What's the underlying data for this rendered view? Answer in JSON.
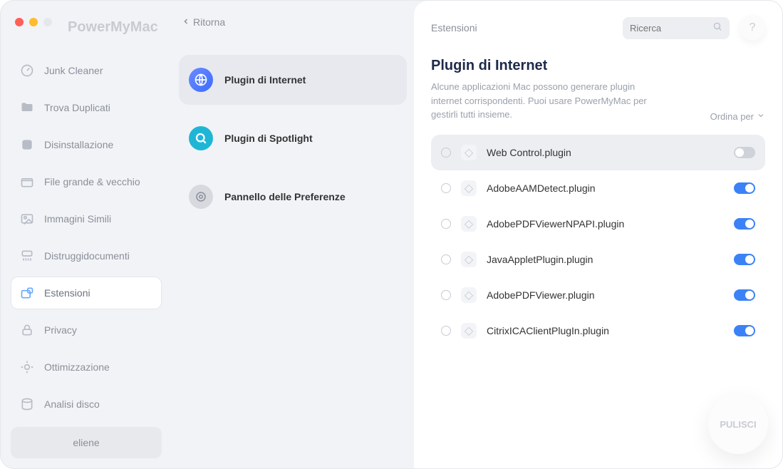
{
  "brand": "PowerMyMac",
  "sidebar": {
    "items": [
      {
        "label": "Junk Cleaner"
      },
      {
        "label": "Trova Duplicati"
      },
      {
        "label": "Disinstallazione"
      },
      {
        "label": "File grande & vecchio"
      },
      {
        "label": "Immagini Simili"
      },
      {
        "label": "Distruggidocumenti"
      },
      {
        "label": "Estensioni"
      },
      {
        "label": "Privacy"
      },
      {
        "label": "Ottimizzazione"
      },
      {
        "label": "Analisi disco"
      }
    ],
    "user": "eliene"
  },
  "back_label": "Ritorna",
  "categories": [
    {
      "label": "Plugin di Internet"
    },
    {
      "label": "Plugin di Spotlight"
    },
    {
      "label": "Pannello delle Preferenze"
    }
  ],
  "breadcrumb": "Estensioni",
  "search_placeholder": "Ricerca",
  "help_label": "?",
  "title": "Plugin di Internet",
  "subtitle": "Alcune applicazioni Mac possono generare plugin internet corrispondenti. Puoi usare PowerMyMac per gestirli tutti insieme.",
  "sort_label": "Ordina per",
  "plugins": [
    {
      "name": "Web Control.plugin",
      "enabled": false,
      "selected": true
    },
    {
      "name": "AdobeAAMDetect.plugin",
      "enabled": true,
      "selected": false
    },
    {
      "name": "AdobePDFViewerNPAPI.plugin",
      "enabled": true,
      "selected": false
    },
    {
      "name": "JavaAppletPlugin.plugin",
      "enabled": true,
      "selected": false
    },
    {
      "name": "AdobePDFViewer.plugin",
      "enabled": true,
      "selected": false
    },
    {
      "name": "CitrixICAClientPlugIn.plugin",
      "enabled": true,
      "selected": false
    }
  ],
  "clean_label": "PULISCI"
}
